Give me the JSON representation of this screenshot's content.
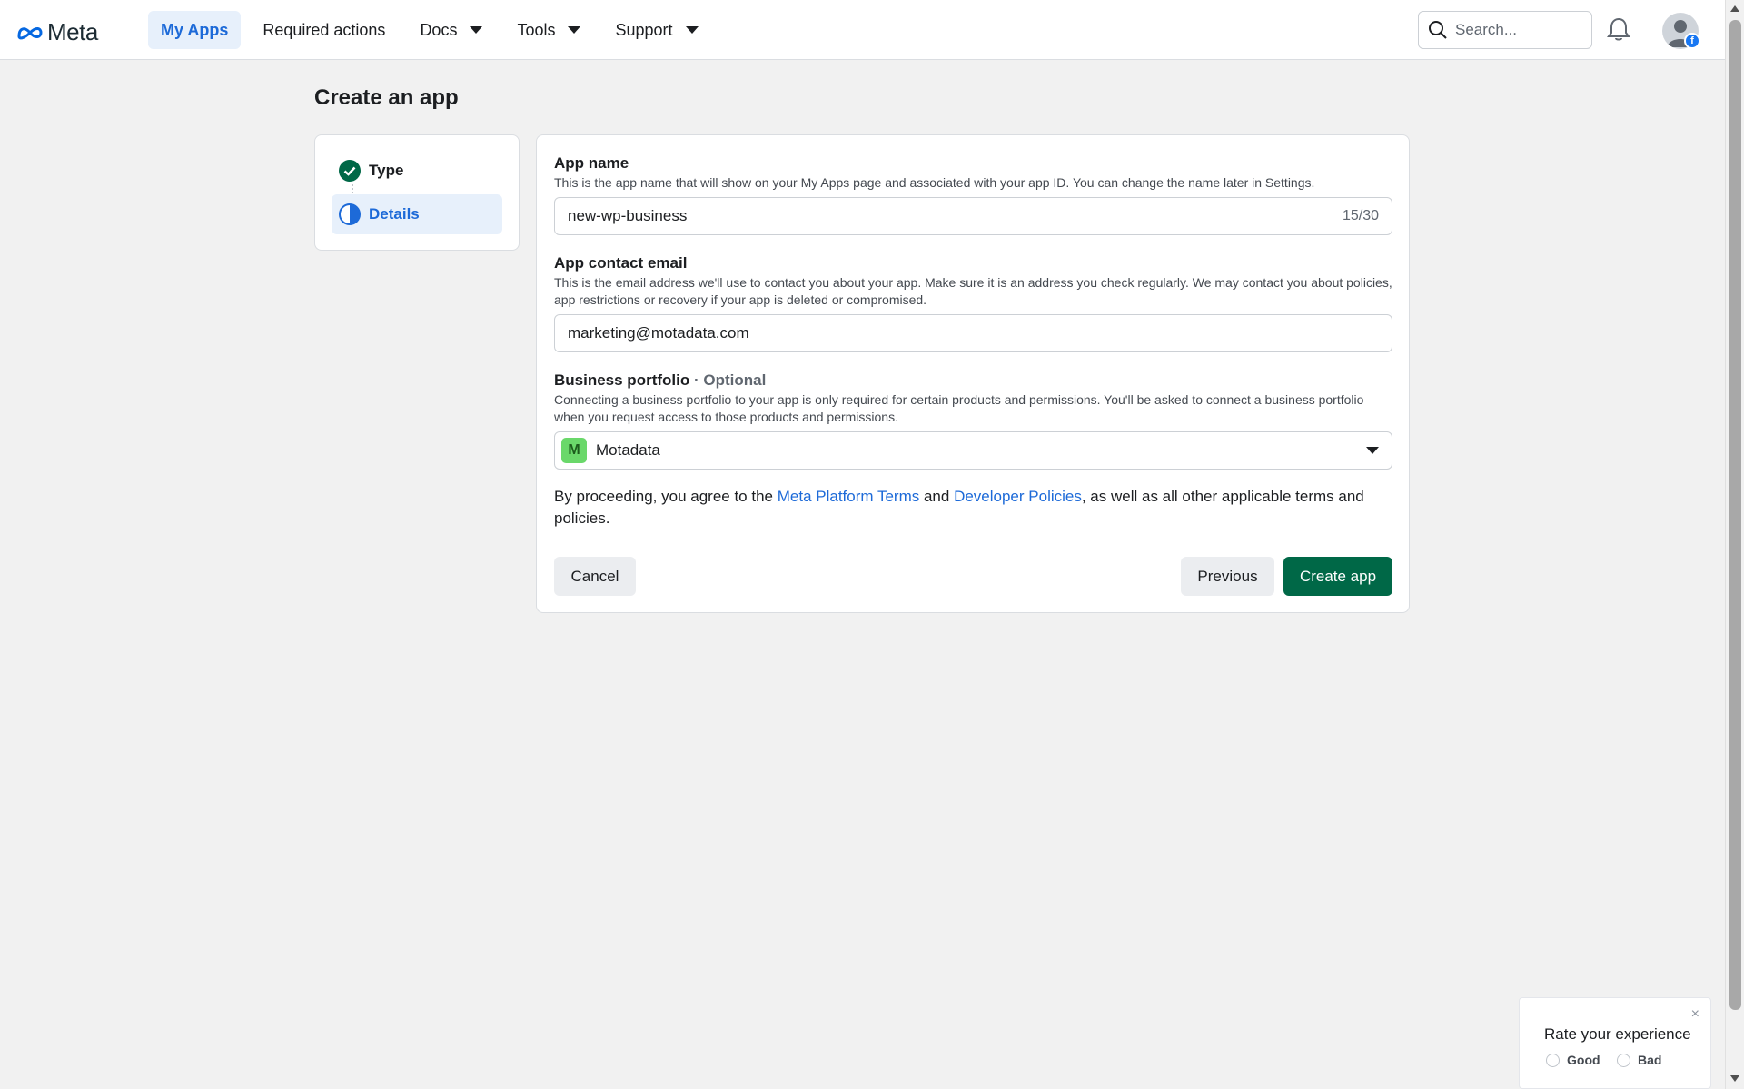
{
  "header": {
    "logo_text": "Meta",
    "nav": {
      "my_apps": "My Apps",
      "required_actions": "Required actions",
      "docs": "Docs",
      "tools": "Tools",
      "support": "Support"
    },
    "search_placeholder": "Search..."
  },
  "page": {
    "title": "Create an app"
  },
  "steps": {
    "type_label": "Type",
    "details_label": "Details"
  },
  "form": {
    "app_name": {
      "label": "App name",
      "help": "This is the app name that will show on your My Apps page and associated with your app ID. You can change the name later in Settings.",
      "value": "new-wp-business",
      "counter": "15/30"
    },
    "contact_email": {
      "label": "App contact email",
      "help": "This is the email address we'll use to contact you about your app. Make sure it is an address you check regularly. We may contact you about policies, app restrictions or recovery if your app is deleted or compromised.",
      "value": "marketing@motadata.com"
    },
    "business_portfolio": {
      "label": "Business portfolio",
      "optional": "· Optional",
      "help": "Connecting a business portfolio to your app is only required for certain products and permissions. You'll be asked to connect a business portfolio when you request access to those products and permissions.",
      "badge": "M",
      "value": "Motadata"
    },
    "terms": {
      "prefix": "By proceeding, you agree to the ",
      "link1": "Meta Platform Terms",
      "middle": " and ",
      "link2": "Developer Policies",
      "suffix": ", as well as all other applicable terms and policies."
    },
    "buttons": {
      "cancel": "Cancel",
      "previous": "Previous",
      "create": "Create app"
    }
  },
  "rating": {
    "title": "Rate your experience",
    "close": "×",
    "good": "Good",
    "bad": "Bad"
  },
  "colors": {
    "primary_button": "#006847",
    "link": "#1d6ad8",
    "active_nav_bg": "#e7f0fb"
  }
}
